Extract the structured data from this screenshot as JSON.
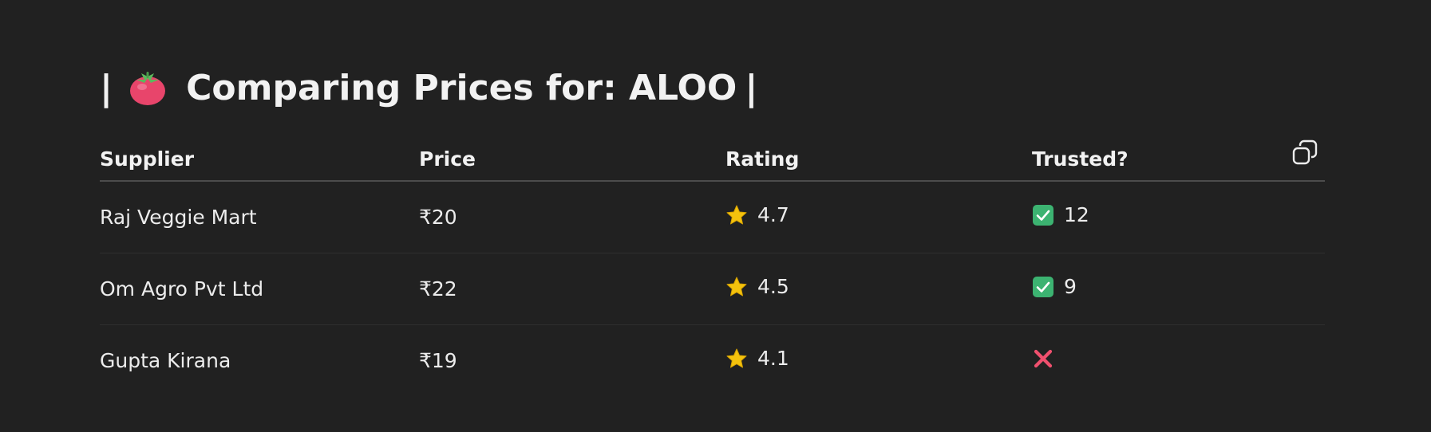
{
  "title": {
    "prefix": "|",
    "text": "Comparing Prices for: ALOO",
    "suffix": "|",
    "emoji": "tomato-icon"
  },
  "table": {
    "headers": [
      "Supplier",
      "Price",
      "Rating",
      "Trusted?"
    ],
    "rows": [
      {
        "supplier": "Raj Veggie Mart",
        "price": "₹20",
        "rating": "4.7",
        "trusted_icon": "check-icon",
        "trusted_value": "12"
      },
      {
        "supplier": "Om Agro Pvt Ltd",
        "price": "₹22",
        "rating": "4.5",
        "trusted_icon": "check-icon",
        "trusted_value": "9"
      },
      {
        "supplier": "Gupta Kirana",
        "price": "₹19",
        "rating": "4.1",
        "trusted_icon": "cross-icon",
        "trusted_value": ""
      }
    ]
  },
  "icons": {
    "rating": "star-icon",
    "copy": "copy-icon"
  },
  "colors": {
    "background": "#212121",
    "text": "#ececec",
    "check_green": "#3cb371",
    "cross_pink": "#f0506e",
    "star_gold": "#f4c20d",
    "tomato_red": "#e8456b"
  }
}
